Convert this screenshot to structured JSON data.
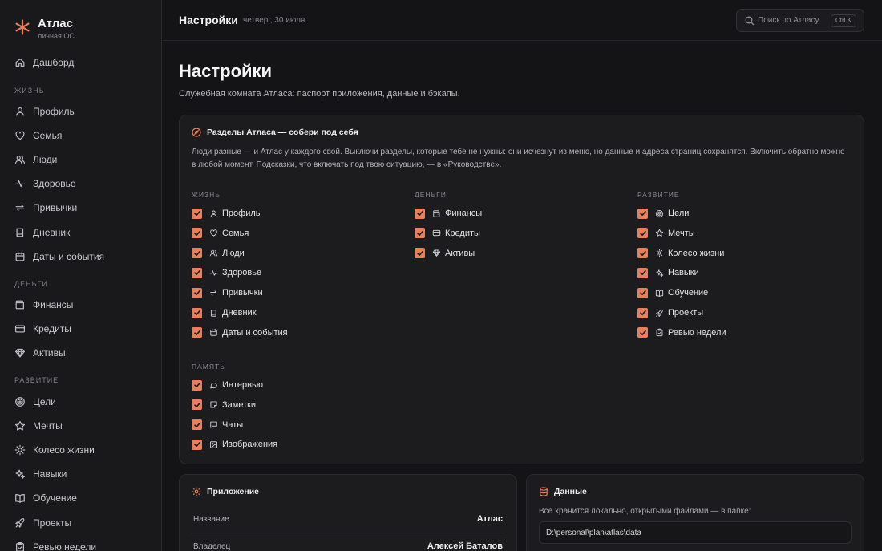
{
  "app": {
    "name": "Атлас",
    "tagline": "личная ОС"
  },
  "sidebar": {
    "dashboard": "Дашборд",
    "sections": {
      "life": "ЖИЗНЬ",
      "money": "ДЕНЬГИ",
      "growth": "РАЗВИТИЕ"
    },
    "life_items": [
      {
        "label": "Профиль",
        "icon": "user-icon"
      },
      {
        "label": "Семья",
        "icon": "heart-icon"
      },
      {
        "label": "Люди",
        "icon": "users-icon"
      },
      {
        "label": "Здоровье",
        "icon": "pulse-icon"
      },
      {
        "label": "Привычки",
        "icon": "repeat-icon"
      },
      {
        "label": "Дневник",
        "icon": "book-icon"
      },
      {
        "label": "Даты и события",
        "icon": "calendar-icon"
      }
    ],
    "money_items": [
      {
        "label": "Финансы",
        "icon": "wallet-icon"
      },
      {
        "label": "Кредиты",
        "icon": "credit-card-icon"
      },
      {
        "label": "Активы",
        "icon": "gem-icon"
      }
    ],
    "growth_items": [
      {
        "label": "Цели",
        "icon": "target-icon"
      },
      {
        "label": "Мечты",
        "icon": "star-icon"
      },
      {
        "label": "Колесо жизни",
        "icon": "sun-icon"
      },
      {
        "label": "Навыки",
        "icon": "sparkles-icon"
      },
      {
        "label": "Обучение",
        "icon": "open-book-icon"
      },
      {
        "label": "Проекты",
        "icon": "rocket-icon"
      },
      {
        "label": "Ревью недели",
        "icon": "clipboard-icon"
      }
    ]
  },
  "topbar": {
    "title": "Настройки",
    "date": "четверг, 30 июля",
    "search_placeholder": "Поиск по Атласу",
    "shortcut": "Ctrl K"
  },
  "page": {
    "title": "Настройки",
    "subtitle": "Служебная комната Атласа: паспорт приложения, данные и бэкапы."
  },
  "sections_card": {
    "title": "Разделы Атласа — собери под себя",
    "description": "Люди разные — и Атлас у каждого свой. Выключи разделы, которые тебе не нужны: они исчезнут из меню, но данные и адреса страниц сохранятся. Включить обратно можно в любой момент. Подсказки, что включать под твою ситуацию, — в «Руководстве».",
    "groups": {
      "life": {
        "label": "ЖИЗНЬ",
        "items": [
          {
            "label": "Профиль",
            "checked": true
          },
          {
            "label": "Семья",
            "checked": true
          },
          {
            "label": "Люди",
            "checked": true
          },
          {
            "label": "Здоровье",
            "checked": true
          },
          {
            "label": "Привычки",
            "checked": true
          },
          {
            "label": "Дневник",
            "checked": true
          },
          {
            "label": "Даты и события",
            "checked": true
          }
        ]
      },
      "money": {
        "label": "ДЕНЬГИ",
        "items": [
          {
            "label": "Финансы",
            "checked": true
          },
          {
            "label": "Кредиты",
            "checked": true
          },
          {
            "label": "Активы",
            "checked": true
          }
        ]
      },
      "growth": {
        "label": "РАЗВИТИЕ",
        "items": [
          {
            "label": "Цели",
            "checked": true
          },
          {
            "label": "Мечты",
            "checked": true
          },
          {
            "label": "Колесо жизни",
            "checked": true
          },
          {
            "label": "Навыки",
            "checked": true
          },
          {
            "label": "Обучение",
            "checked": true
          },
          {
            "label": "Проекты",
            "checked": true
          },
          {
            "label": "Ревью недели",
            "checked": true
          }
        ]
      },
      "memory": {
        "label": "ПАМЯТЬ",
        "items": [
          {
            "label": "Интервью",
            "checked": true
          },
          {
            "label": "Заметки",
            "checked": true
          },
          {
            "label": "Чаты",
            "checked": true
          },
          {
            "label": "Изображения",
            "checked": true
          }
        ]
      }
    }
  },
  "app_card": {
    "title": "Приложение",
    "rows": [
      {
        "key": "Название",
        "value": "Атлас"
      },
      {
        "key": "Владелец",
        "value": "Алексей Баталов"
      }
    ]
  },
  "data_card": {
    "title": "Данные",
    "description": "Всё хранится локально, открытыми файлами — в папке:",
    "path": "D:\\personal\\plan\\atlas\\data"
  },
  "colors": {
    "accent": "#e8805b",
    "background": "#141416",
    "card": "#1c1c1f"
  }
}
